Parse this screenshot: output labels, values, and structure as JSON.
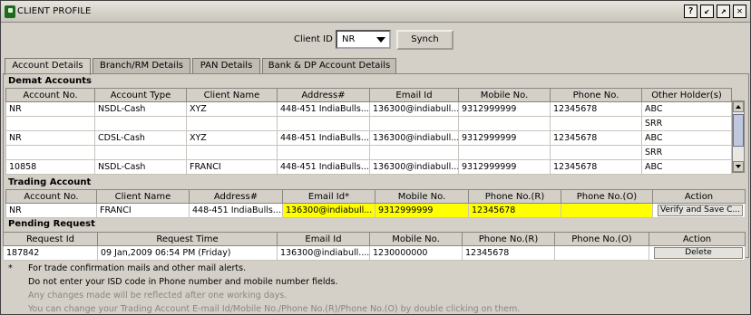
{
  "window": {
    "title": "CLIENT PROFILE",
    "buttons": [
      "?",
      "↙",
      "↗",
      "✕"
    ]
  },
  "client": {
    "label": "Client ID",
    "value": "NR",
    "synch_label": "Synch"
  },
  "tabs": [
    {
      "label": "Account Details",
      "active": true
    },
    {
      "label": "Branch/RM Details",
      "active": false
    },
    {
      "label": "PAN Details",
      "active": false
    },
    {
      "label": "Bank & DP Account Details",
      "active": false
    }
  ],
  "demat": {
    "title": "Demat Accounts",
    "headers": [
      "Account No.",
      "Account Type",
      "Client Name",
      "Address#",
      "Email Id",
      "Mobile No.",
      "Phone No.",
      "Other Holder(s)"
    ],
    "rows": [
      [
        "NR",
        "NSDL-Cash",
        "XYZ",
        "448-451 IndiaBulls...",
        "136300@indiabull...",
        "9312999999",
        "12345678",
        "ABC"
      ],
      [
        "",
        "",
        "",
        "",
        "",
        "",
        "",
        "SRR"
      ],
      [
        "NR",
        "CDSL-Cash",
        "XYZ",
        "448-451 IndiaBulls...",
        "136300@indiabull...",
        "9312999999",
        "12345678",
        "ABC"
      ],
      [
        "",
        "",
        "",
        "",
        "",
        "",
        "",
        "SRR"
      ],
      [
        "10858",
        "NSDL-Cash",
        "FRANCI",
        "448-451 IndiaBulls...",
        "136300@indiabull...",
        "9312999999",
        "12345678",
        "ABC"
      ]
    ]
  },
  "trading": {
    "title": "Trading Account",
    "headers": [
      "Account No.",
      "Client Name",
      "Address#",
      "Email Id*",
      "Mobile No.",
      "Phone No.(R)",
      "Phone No.(O)",
      "Action"
    ],
    "row": [
      "NR",
      "FRANCI",
      "448-451 IndiaBulls...",
      "136300@indiabull...",
      "9312999999",
      "12345678",
      "",
      "Verify and Save C..."
    ]
  },
  "pending": {
    "title": "Pending Request",
    "headers": [
      "Request Id",
      "Request Time",
      "Email Id",
      "Mobile No.",
      "Phone No.(R)",
      "Phone No.(O)",
      "Action"
    ],
    "row": [
      "187842",
      "09 Jan,2009 06:54 PM (Friday)",
      "136300@indiabull....",
      "1230000000",
      "12345678",
      "",
      "Delete"
    ]
  },
  "notes": {
    "star": "*",
    "line1": "For trade confirmation mails and other mail alerts.",
    "line2": "Do not enter your ISD code in Phone number and mobile number fields.",
    "line3": "Any changes made will be reflected after one working days.",
    "line4": "You can change your Trading Account E-mail Id/Mobile No./Phone No.(R)/Phone No.(O) by double clicking on them."
  },
  "colors": {
    "highlight": "#ffff00",
    "window_bg": "#d4d0c8"
  }
}
